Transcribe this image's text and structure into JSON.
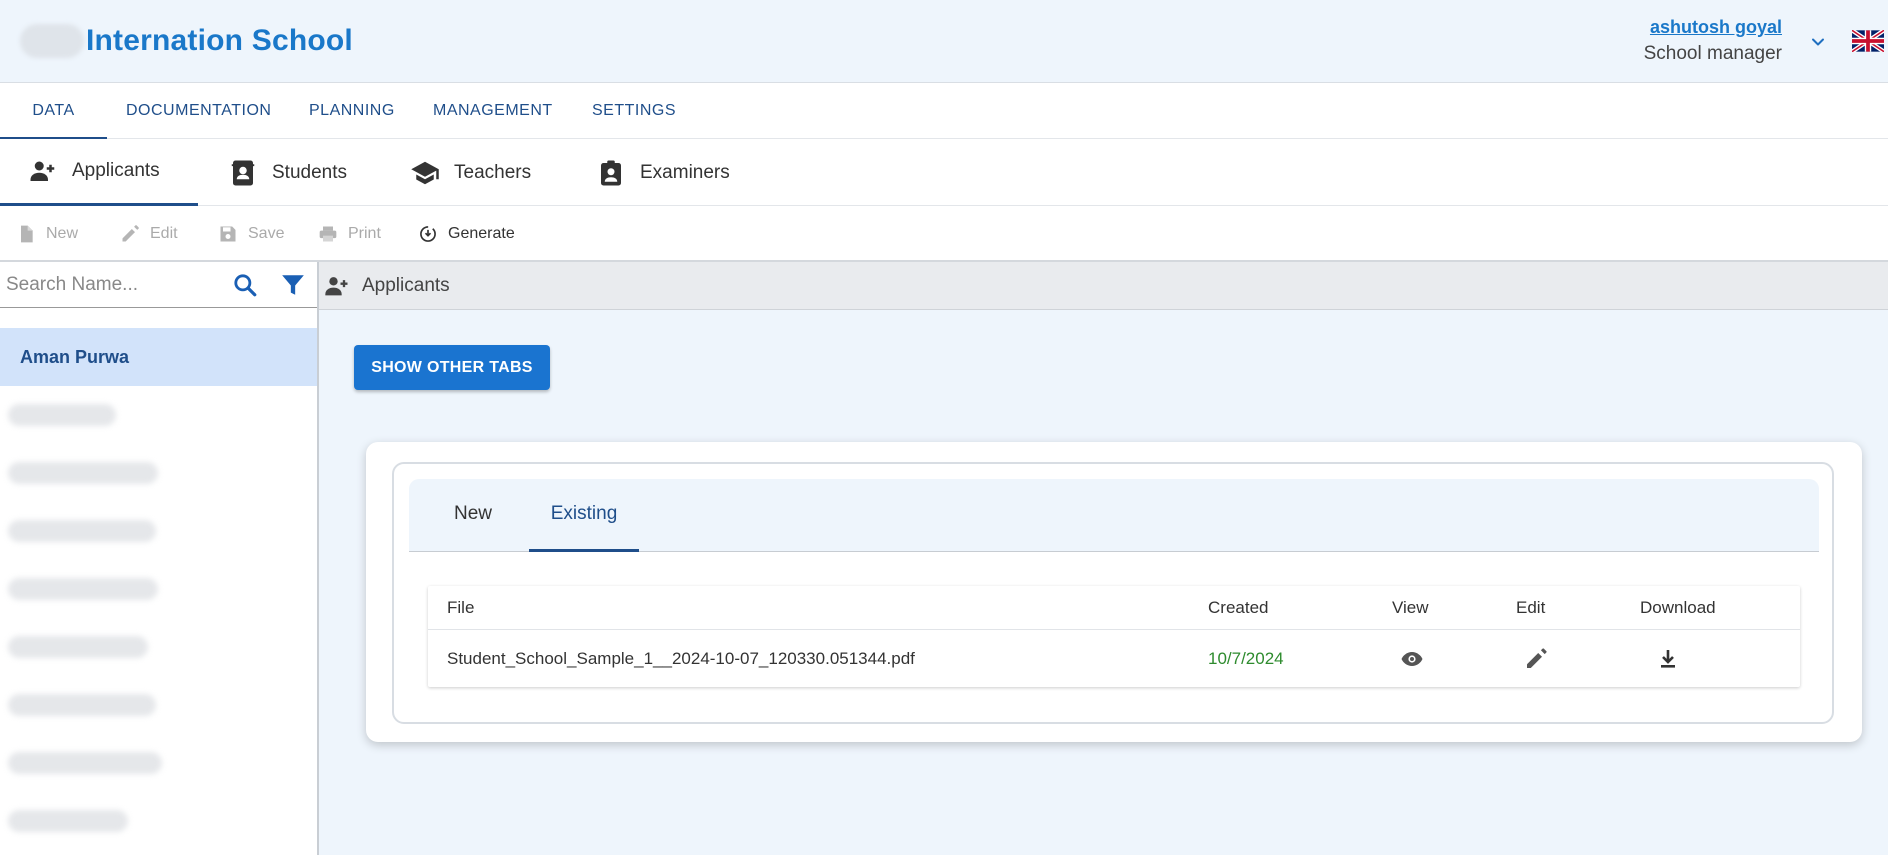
{
  "header": {
    "title": "Internation School",
    "user_name": "ashutosh goyal",
    "user_role": "School manager"
  },
  "topnav": [
    {
      "label": "DATA",
      "active": true
    },
    {
      "label": "DOCUMENTATION"
    },
    {
      "label": "PLANNING"
    },
    {
      "label": "MANAGEMENT"
    },
    {
      "label": "SETTINGS"
    }
  ],
  "subtabs": [
    {
      "label": "Applicants",
      "icon": "add-person-icon",
      "active": true
    },
    {
      "label": "Students",
      "icon": "contact-book-icon"
    },
    {
      "label": "Teachers",
      "icon": "school-icon"
    },
    {
      "label": "Examiners",
      "icon": "badge-icon"
    }
  ],
  "toolbar": [
    {
      "label": "New",
      "icon": "file-icon",
      "enabled": false
    },
    {
      "label": "Edit",
      "icon": "pencil-icon",
      "enabled": false
    },
    {
      "label": "Save",
      "icon": "floppy-icon",
      "enabled": false
    },
    {
      "label": "Print",
      "icon": "printer-icon",
      "enabled": false
    },
    {
      "label": "Generate",
      "icon": "generate-icon",
      "enabled": true
    }
  ],
  "search": {
    "placeholder": "Search Name...",
    "value": ""
  },
  "names": [
    {
      "label": "Aman Purwa",
      "selected": true
    }
  ],
  "main": {
    "header_label": "Applicants",
    "show_tabs_label": "SHOW OTHER TABS",
    "card_tabs": [
      {
        "label": "New"
      },
      {
        "label": "Existing",
        "active": true
      }
    ],
    "table": {
      "columns": [
        "File",
        "Created",
        "View",
        "Edit",
        "Download"
      ],
      "rows": [
        {
          "file": "Student_School_Sample_1__2024-10-07_120330.051344.pdf",
          "created": "10/7/2024"
        }
      ]
    }
  },
  "colors": {
    "accent": "#1a74d0",
    "title_blue": "#1a78c9",
    "nav_blue": "#1f4e8a",
    "created_green": "#2e8b2e",
    "selected_bg": "#d2e3fa"
  }
}
